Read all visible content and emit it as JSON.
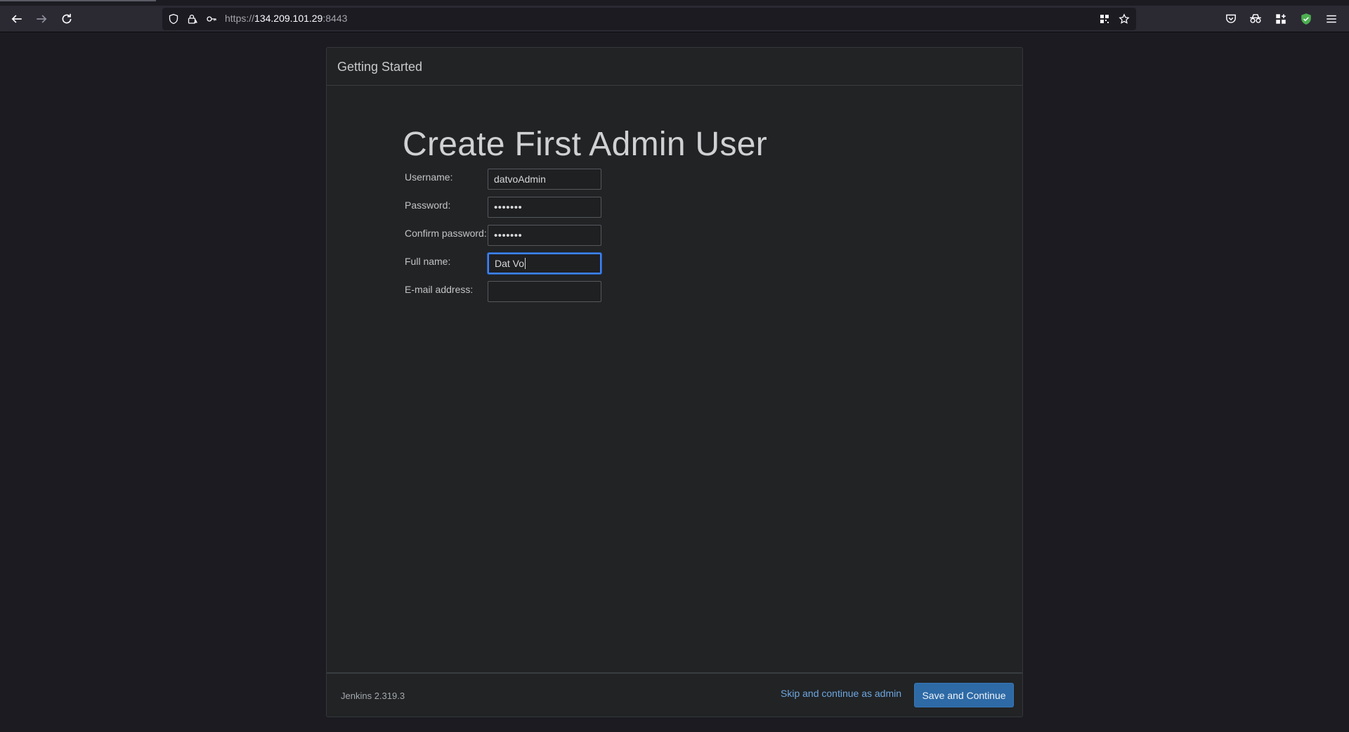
{
  "browser": {
    "url_scheme": "https://",
    "url_host": "134.209.101.29",
    "url_port": ":8443",
    "icons": [
      "back-icon",
      "forward-icon",
      "reload-icon",
      "shield-icon",
      "lock-warning-icon",
      "key-icon",
      "qr-grid-icon",
      "bookmark-star-icon",
      "pocket-icon",
      "incognito-icon",
      "extensions-icon",
      "shield-extension-icon",
      "menu-icon"
    ]
  },
  "panel": {
    "title": "Getting Started"
  },
  "form": {
    "heading": "Create First Admin User",
    "fields": [
      {
        "label": "Username:",
        "value": "datvoAdmin",
        "type": "text"
      },
      {
        "label": "Password:",
        "value": "•••••••",
        "type": "password"
      },
      {
        "label": "Confirm password:",
        "value": "•••••••",
        "type": "password"
      },
      {
        "label": "Full name:",
        "value": "Dat Vo",
        "type": "text",
        "focused": true
      },
      {
        "label": "E-mail address:",
        "value": "",
        "type": "text"
      }
    ]
  },
  "footer": {
    "version": "Jenkins 2.319.3",
    "skip_label": "Skip and continue as admin",
    "save_label": "Save and Continue"
  },
  "colors": {
    "accent": "#2d6aa6",
    "link": "#6ea7e0",
    "focus": "#3c82f6"
  }
}
